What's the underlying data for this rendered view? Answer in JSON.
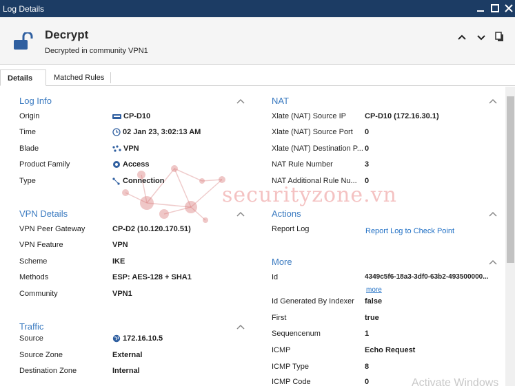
{
  "window": {
    "title": "Log Details"
  },
  "header": {
    "title": "Decrypt",
    "subtitle": "Decrypted in community VPN1"
  },
  "tabs": [
    {
      "label": "Details"
    },
    {
      "label": "Matched Rules"
    }
  ],
  "log_info": {
    "title": "Log Info",
    "rows": [
      {
        "label": "Origin",
        "value": "CP-D10",
        "icon": "gateway-icon"
      },
      {
        "label": "Time",
        "value": "02 Jan 23, 3:02:13 AM",
        "icon": "clock-icon"
      },
      {
        "label": "Blade",
        "value": "VPN",
        "icon": "vpn-icon"
      },
      {
        "label": "Product Family",
        "value": "Access",
        "icon": "access-icon"
      },
      {
        "label": "Type",
        "value": "Connection",
        "icon": "connection-icon"
      }
    ]
  },
  "vpn_details": {
    "title": "VPN Details",
    "rows": [
      {
        "label": "VPN Peer Gateway",
        "value": "CP-D2 (10.120.170.51)"
      },
      {
        "label": "VPN Feature",
        "value": "VPN"
      },
      {
        "label": "Scheme",
        "value": "IKE"
      },
      {
        "label": "Methods",
        "value": "ESP: AES-128 + SHA1"
      },
      {
        "label": "Community",
        "value": "VPN1"
      }
    ]
  },
  "traffic": {
    "title": "Traffic",
    "rows": [
      {
        "label": "Source",
        "value": "172.16.10.5",
        "icon": "globe-icon"
      },
      {
        "label": "Source Zone",
        "value": "External"
      },
      {
        "label": "Destination Zone",
        "value": "Internal"
      }
    ]
  },
  "nat": {
    "title": "NAT",
    "rows": [
      {
        "label": "Xlate (NAT) Source IP",
        "value": "CP-D10 (172.16.30.1)"
      },
      {
        "label": "Xlate (NAT) Source Port",
        "value": "0"
      },
      {
        "label": "Xlate (NAT) Destination P...",
        "value": "0"
      },
      {
        "label": "NAT Rule Number",
        "value": "3"
      },
      {
        "label": "NAT Additional Rule Nu...",
        "value": "0"
      }
    ]
  },
  "actions": {
    "title": "Actions",
    "rows": [
      {
        "label": "Report Log",
        "link": "Report Log to Check Point"
      }
    ]
  },
  "more": {
    "title": "More",
    "id_label": "Id",
    "id_value": "4349c5f6-18a3-3df0-63b2-493500000...",
    "more_link": "more",
    "rows": [
      {
        "label": "Id Generated By Indexer",
        "value": "false"
      },
      {
        "label": "First",
        "value": "true"
      },
      {
        "label": "Sequencenum",
        "value": "1"
      },
      {
        "label": "ICMP",
        "value": "Echo Request"
      },
      {
        "label": "ICMP Type",
        "value": "8"
      },
      {
        "label": "ICMP Code",
        "value": "0"
      }
    ]
  },
  "watermark": {
    "text": "securityzone.vn",
    "os_notice": "Activate Windows"
  },
  "colors": {
    "titlebar": "#1c3c64",
    "section_title": "#3a7ac0",
    "link": "#1f6fc4",
    "icon_blue": "#2f5fa0"
  }
}
